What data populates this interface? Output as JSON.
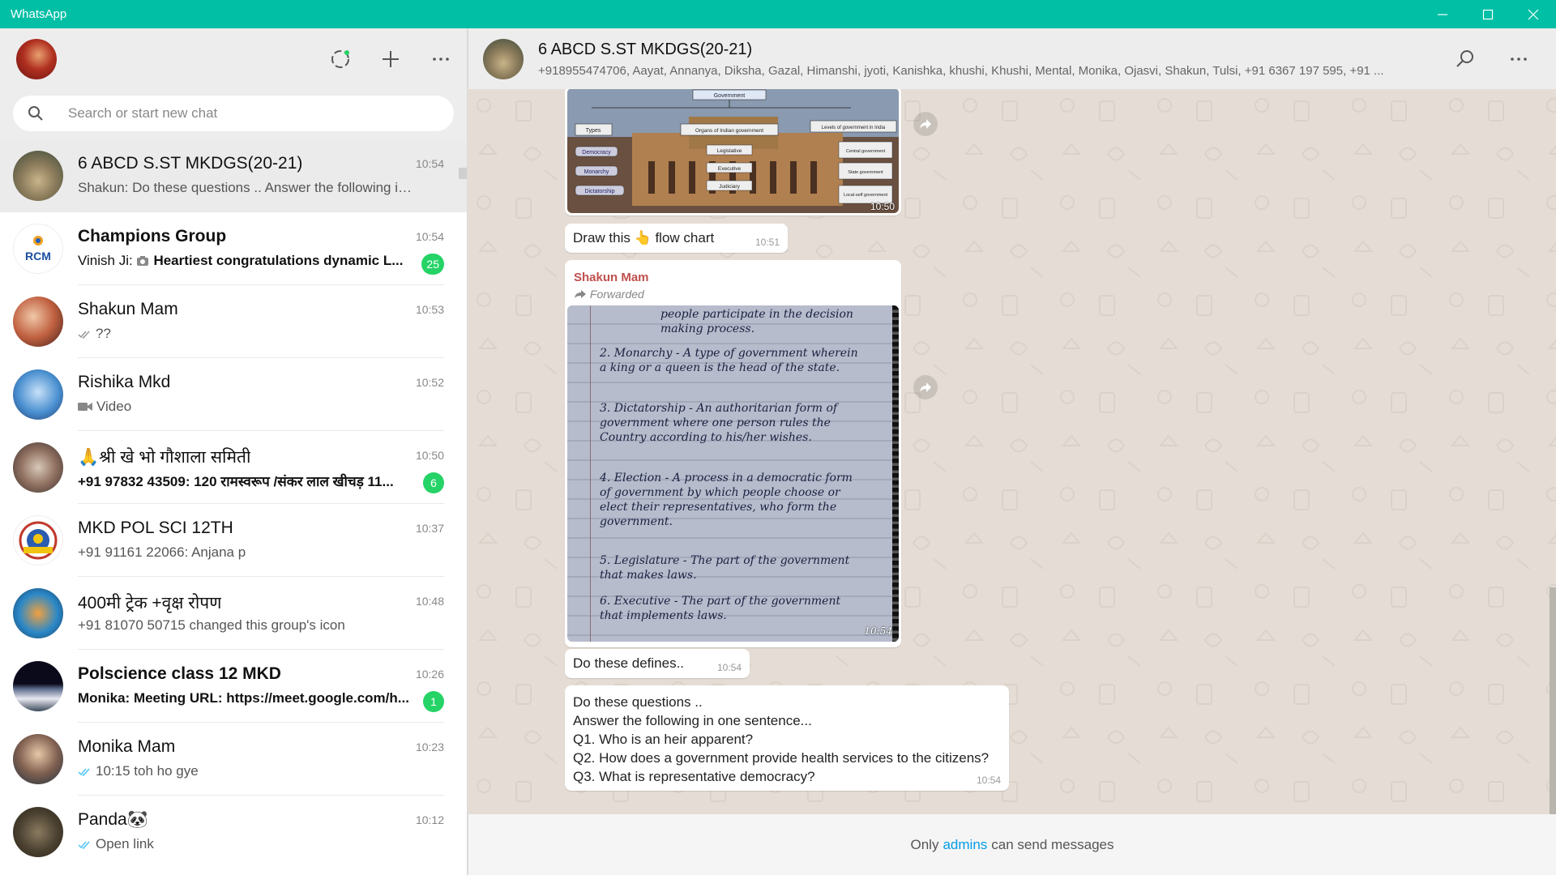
{
  "window": {
    "title": "WhatsApp"
  },
  "sidebar": {
    "search": {
      "placeholder": "Search or start new chat"
    },
    "chats": [
      {
        "name": "6 ABCD S.ST MKDGS(20-21)",
        "time": "10:54",
        "preview": "Shakun: Do these questions .. Answer the following in o...",
        "active": true
      },
      {
        "name": "Champions Group",
        "time": "10:54",
        "sender": "Vinish Ji: ",
        "preview": "Heartiest congratulations dynamic L...",
        "badge": "25"
      },
      {
        "name": "Shakun Mam",
        "time": "10:53",
        "preview": "??"
      },
      {
        "name": "Rishika Mkd",
        "time": "10:52",
        "preview": "Video"
      },
      {
        "name": "🙏श्री खे भो गौशाला समिती",
        "time": "10:50",
        "preview": "+91 97832 43509: 120 रामस्वरूप /संकर लाल खीचड़ 11...",
        "badge": "6"
      },
      {
        "name": "MKD POL SCI 12TH",
        "time": "10:37",
        "preview": "+91 91161 22066: Anjana p"
      },
      {
        "name": "400मी ट्रेक +वृक्ष रोपण",
        "time": "10:48",
        "preview": "+91 81070 50715 changed this group's icon"
      },
      {
        "name": "Polscience class 12 MKD",
        "time": "10:26",
        "preview": "Monika: Meeting URL: https://meet.google.com/h...",
        "badge": "1"
      },
      {
        "name": "Monika Mam",
        "time": "10:23",
        "preview": "10:15 toh ho gye"
      },
      {
        "name": "Panda🐼",
        "time": "10:12",
        "preview": "Open link"
      }
    ]
  },
  "chat": {
    "name": "6 ABCD S.ST MKDGS(20-21)",
    "members": "+918955474706, Aayat, Annanya, Diksha, Gazal, Himanshi, jyoti, Kanishka, khushi, Khushi, Mental, Monika, Ojasvi, Shakun, Tulsi, +91 6367 197 595, +91 ...",
    "image1": {
      "time": "10:50",
      "labels": [
        "Government",
        "Types",
        "Organs of Indian government",
        "Levels of government in India",
        "Democracy",
        "Monarchy",
        "Dictatorship",
        "Legislative",
        "Executive",
        "Judiciary",
        "Central government",
        "State government",
        "Local-self government"
      ]
    },
    "msg_draw": {
      "text": "Draw this 👆 flow chart",
      "time": "10:51"
    },
    "forward": {
      "sender": "Shakun Mam",
      "forwarded_label": "Forwarded",
      "time": "10:54",
      "note_lines": [
        "people participate in the decision making process.",
        "2. Monarchy - A type of government wherein a king or a queen is the head of the state.",
        "3. Dictatorship - An authoritarian form of government where one person rules the Country according to his/her wishes.",
        "4. Election - A process in a democratic form of government by which people choose or elect their representatives, who form the government.",
        "5. Legislature - The part of the government that makes laws.",
        "6. Executive - The part of the government that implements laws."
      ]
    },
    "msg_defines": {
      "text": "Do these defines..",
      "time": "10:54"
    },
    "msg_questions": {
      "lines": [
        "Do these questions ..",
        "Answer the following in one sentence...",
        "Q1. Who is an heir apparent?",
        "Q2. How does a government provide health services to the citizens?",
        "Q3. What is representative democracy?"
      ],
      "time": "10:54"
    },
    "footer": {
      "prefix": "Only",
      "link": "admins",
      "suffix": "can send messages"
    }
  },
  "colors": {
    "titlebar": "#00bfa5",
    "badge": "#25d366",
    "sender_name": "#c0504d",
    "link": "#039be5",
    "chat_bg": "#e5ddd5"
  }
}
